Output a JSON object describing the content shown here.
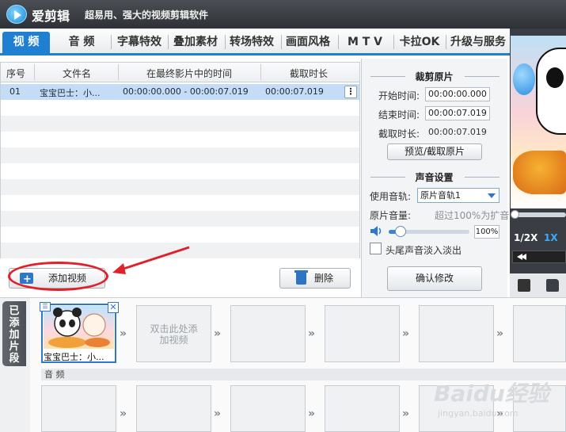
{
  "app": {
    "name": "爱剪辑",
    "slogan": "超易用、强大的视频剪辑软件"
  },
  "tabs": [
    {
      "label": "视 频",
      "active": true
    },
    {
      "label": "音 频"
    },
    {
      "label": "字幕特效"
    },
    {
      "label": "叠加素材"
    },
    {
      "label": "转场特效"
    },
    {
      "label": "画面风格"
    },
    {
      "label": "M T V"
    },
    {
      "label": "卡拉OK"
    },
    {
      "label": "升级与服务"
    }
  ],
  "table": {
    "headers": [
      "序号",
      "文件名",
      "在最终影片中的时间",
      "截取时长"
    ],
    "rows": [
      {
        "index": "01",
        "filename": "宝宝巴士：小...",
        "time_range": "00:00:00.000 - 00:00:07.019",
        "duration": "00:00:07.019"
      }
    ]
  },
  "buttons": {
    "add_video": "添加视频",
    "delete": "删除",
    "preview_cut": "预览/截取原片",
    "confirm": "确认修改"
  },
  "crop": {
    "title": "裁剪原片",
    "start_label": "开始时间:",
    "start_value": "00:00:00.000",
    "end_label": "结束时间:",
    "end_value": "00:00:07.019",
    "duration_label": "截取时长:",
    "duration_value": "00:00:07.019"
  },
  "sound": {
    "title": "声音设置",
    "track_label": "使用音轨:",
    "track_value": "原片音轨1",
    "volume_label": "原片音量:",
    "volume_hint": "超过100%为扩音",
    "volume_percent": "100%",
    "volume_level": 0.15,
    "fade_label": "头尾声音淡入淡出",
    "fade_checked": false
  },
  "preview": {
    "speed_left": "1/2X",
    "speed_right": "1X"
  },
  "timeline": {
    "side_tab": "已添加片段",
    "clip_label": "宝宝巴士：小...",
    "empty_hint": "双击此处添加视频",
    "audio_label": "音 频"
  },
  "watermark": {
    "brand": "Baidu经验",
    "url": "jingyan.baidu.com"
  },
  "colors": {
    "accent": "#1f7fd0",
    "annotation": "#e0202a",
    "selected_row": "#c4dcf6"
  }
}
